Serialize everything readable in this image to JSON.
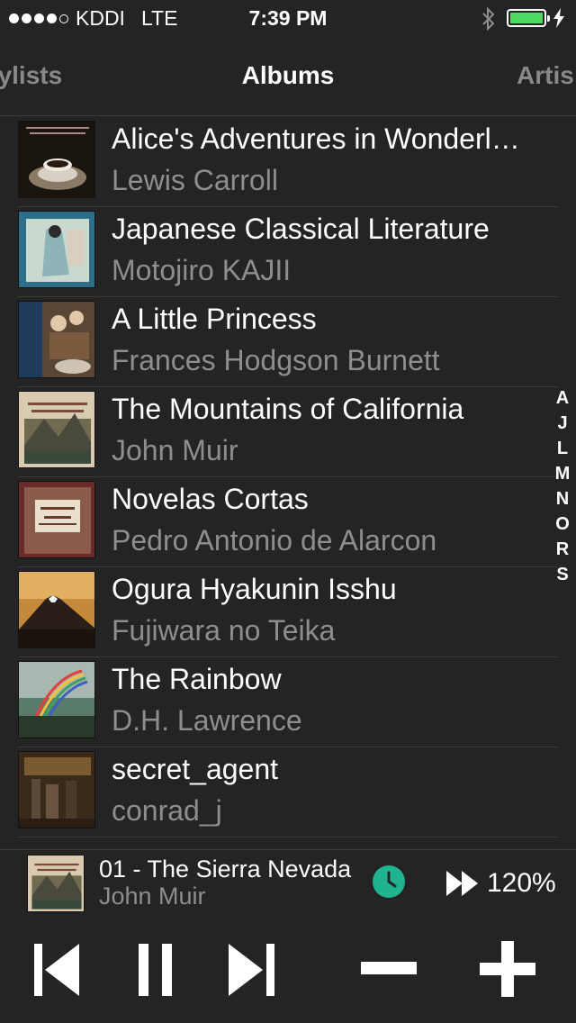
{
  "status_bar": {
    "carrier": "KDDI",
    "network": "LTE",
    "time": "7:39 PM",
    "battery_color": "#4cd964"
  },
  "tabs": {
    "left": "aylists",
    "center": "Albums",
    "right": "Artis"
  },
  "albums": [
    {
      "title": "Alice's Adventures in Wonderland",
      "artist": "Lewis Carroll"
    },
    {
      "title": "Japanese Classical Literature",
      "artist": "Motojiro KAJII"
    },
    {
      "title": "A Little Princess",
      "artist": "Frances Hodgson Burnett"
    },
    {
      "title": "The Mountains of California",
      "artist": "John Muir"
    },
    {
      "title": "Novelas Cortas",
      "artist": "Pedro Antonio de Alarcon"
    },
    {
      "title": "Ogura Hyakunin Isshu",
      "artist": "Fujiwara no Teika"
    },
    {
      "title": "The Rainbow",
      "artist": "D.H. Lawrence"
    },
    {
      "title": "secret_agent",
      "artist": "conrad_j"
    }
  ],
  "index_letters": [
    "A",
    "J",
    "L",
    "M",
    "N",
    "O",
    "R",
    "S"
  ],
  "now_playing": {
    "track": "01 - The Sierra Nevada",
    "artist": "John Muir",
    "speed": "120%",
    "accent_color": "#1fb38f"
  },
  "controls": [
    "previous-icon",
    "pause-icon",
    "next-icon",
    "minus-icon",
    "plus-icon"
  ]
}
